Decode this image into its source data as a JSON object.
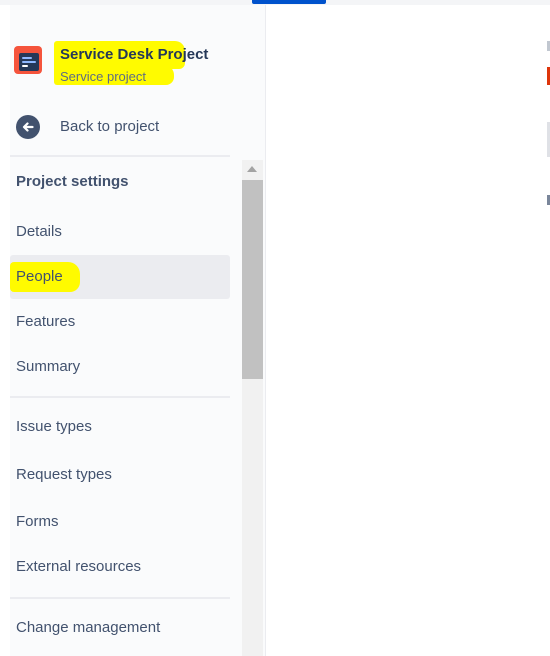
{
  "project": {
    "name": "Service Desk Project",
    "type": "Service project"
  },
  "back": {
    "label": "Back to project",
    "icon": "arrow-left-icon"
  },
  "settings": {
    "heading": "Project settings",
    "items": [
      {
        "label": "Details"
      },
      {
        "label": "People",
        "selected": true
      },
      {
        "label": "Features"
      },
      {
        "label": "Summary"
      }
    ],
    "items2": [
      {
        "label": "Issue types"
      },
      {
        "label": "Request types"
      },
      {
        "label": "Forms"
      },
      {
        "label": "External resources"
      }
    ],
    "items3": [
      {
        "label": "Change management"
      }
    ]
  },
  "colors": {
    "highlight": "#fffb00",
    "accent": "#0052cc",
    "selected_bg": "#ebecf0",
    "avatar": "#f5543c"
  }
}
